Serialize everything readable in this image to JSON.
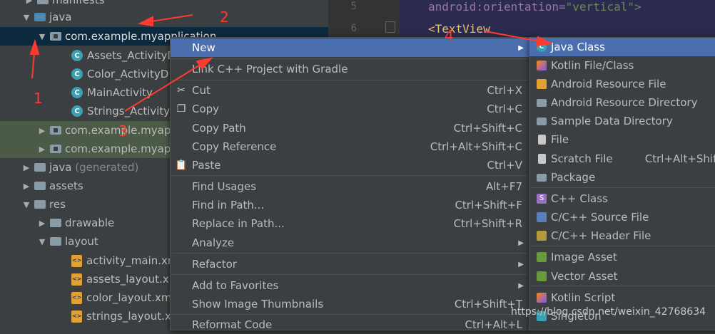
{
  "tree": {
    "manifests": "manifests",
    "java": "java",
    "package_main": "com.example.myapplication",
    "classes": [
      "Assets_ActivityD",
      "Color_ActivityD",
      "MainActivity",
      "Strings_Activityl"
    ],
    "package_test1": "com.example.myap",
    "package_test2": "com.example.myap",
    "java_gen": "java",
    "java_gen_suffix": "(generated)",
    "assets": "assets",
    "res": "res",
    "drawable": "drawable",
    "layout": "layout",
    "layouts": [
      "activity_main.xm",
      "assets_layout.xm",
      "color_layout.xm",
      "strings_layout.xn"
    ]
  },
  "editor": {
    "line5": "5",
    "line6": "6",
    "attr_prefix": "android:orientation=",
    "attr_value": "\"vertical\">",
    "tag": "<TextView"
  },
  "context_menu": {
    "new": "New",
    "link_cpp": "Link C++ Project with Gradle",
    "cut": "Cut",
    "cut_sc": "Ctrl+X",
    "copy": "Copy",
    "copy_sc": "Ctrl+C",
    "copy_path": "Copy Path",
    "copy_path_sc": "Ctrl+Shift+C",
    "copy_ref": "Copy Reference",
    "copy_ref_sc": "Ctrl+Alt+Shift+C",
    "paste": "Paste",
    "paste_sc": "Ctrl+V",
    "find_usages": "Find Usages",
    "find_usages_sc": "Alt+F7",
    "find_in_path": "Find in Path...",
    "find_in_path_sc": "Ctrl+Shift+F",
    "replace_in_path": "Replace in Path...",
    "replace_in_path_sc": "Ctrl+Shift+R",
    "analyze": "Analyze",
    "refactor": "Refactor",
    "add_favorites": "Add to Favorites",
    "show_thumbnails": "Show Image Thumbnails",
    "show_thumbnails_sc": "Ctrl+Shift+T",
    "reformat": "Reformat Code",
    "reformat_sc": "Ctrl+Alt+L"
  },
  "new_submenu": {
    "java_class": "Java Class",
    "kotlin_file": "Kotlin File/Class",
    "android_res_file": "Android Resource File",
    "android_res_dir": "Android Resource Directory",
    "sample_data_dir": "Sample Data Directory",
    "file": "File",
    "scratch_file": "Scratch File",
    "scratch_file_sc": "Ctrl+Alt+Shift",
    "package": "Package",
    "cpp_class": "C++ Class",
    "cpp_source": "C/C++ Source File",
    "cpp_header": "C/C++ Header File",
    "image_asset": "Image Asset",
    "vector_asset": "Vector Asset",
    "kotlin_script": "Kotlin Script",
    "singleton": "Singleton"
  },
  "annotations": {
    "a1": "1",
    "a2": "2",
    "a3": "3",
    "a4": "4"
  },
  "watermark": "https://blog.csdn.net/weixin_42768634",
  "colors": {
    "selection": "#4b6eaf",
    "tree_selection": "#0d293e",
    "annotation": "#ff3b30"
  }
}
